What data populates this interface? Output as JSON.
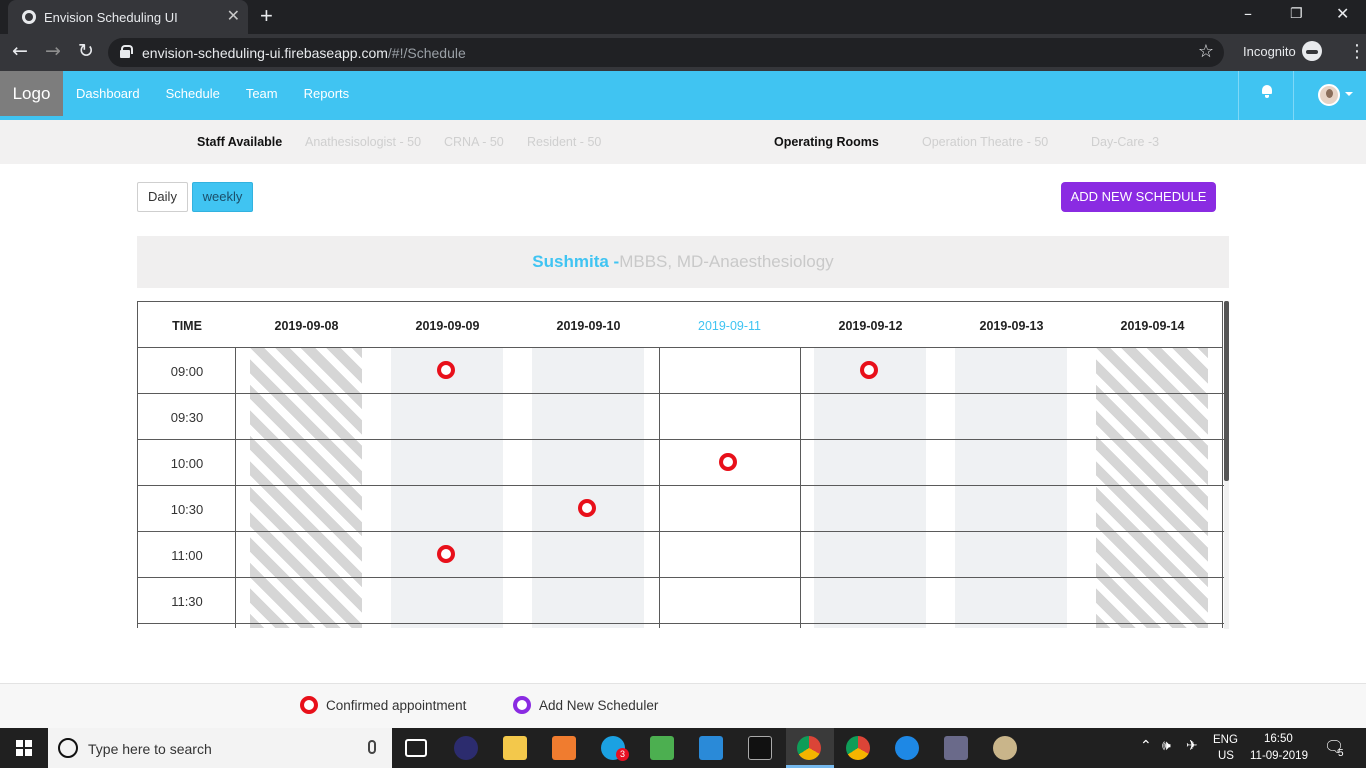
{
  "browser": {
    "tab_title": "Envision Scheduling UI",
    "close_glyph": "✕",
    "new_tab_glyph": "+",
    "url_host": "envision-scheduling-ui.firebaseapp.com",
    "url_path": "/#!/Schedule",
    "mode": "Incognito",
    "win_minimize": "–",
    "win_restore": "❐",
    "win_close": "✕",
    "back_glyph": "←",
    "forward_glyph": "→",
    "reload_glyph": "↻",
    "star_glyph": "☆",
    "menu_glyph": "⋮"
  },
  "header": {
    "logo": "Logo",
    "nav": [
      "Dashboard",
      "Schedule",
      "Team",
      "Reports"
    ],
    "accent_color": "#40c4f2"
  },
  "summary": {
    "staff_label": "Staff Available",
    "staff": [
      "Anathesisologist - 50",
      "CRNA - 50",
      "Resident - 50"
    ],
    "rooms_label": "Operating Rooms",
    "rooms": [
      "Operation Theatre - 50",
      "Day-Care -3"
    ]
  },
  "controls": {
    "daily": "Daily",
    "weekly": "weekly",
    "active_view": "weekly",
    "add_schedule": "ADD NEW SCHEDULE",
    "add_color": "#8a2be2"
  },
  "doctor": {
    "name": "Sushmita -",
    "qualifications": "MBBS, MD-Anaesthesiology"
  },
  "schedule": {
    "time_header": "TIME",
    "days": [
      {
        "date": "2019-09-08",
        "style": "blocked"
      },
      {
        "date": "2019-09-09",
        "style": "shaded"
      },
      {
        "date": "2019-09-10",
        "style": "shaded"
      },
      {
        "date": "2019-09-11",
        "style": "today"
      },
      {
        "date": "2019-09-12",
        "style": "shaded"
      },
      {
        "date": "2019-09-13",
        "style": "shaded"
      },
      {
        "date": "2019-09-14",
        "style": "blocked"
      }
    ],
    "times": [
      "09:00",
      "09:30",
      "10:00",
      "10:30",
      "11:00",
      "11:30"
    ],
    "appointments": [
      {
        "day": "2019-09-09",
        "time": "09:00"
      },
      {
        "day": "2019-09-12",
        "time": "09:00"
      },
      {
        "day": "2019-09-11",
        "time": "10:00"
      },
      {
        "day": "2019-09-10",
        "time": "10:30"
      },
      {
        "day": "2019-09-09",
        "time": "11:00"
      }
    ],
    "appointment_color": "#e8101a"
  },
  "legend": {
    "confirmed": "Confirmed appointment",
    "add_new": "Add New Scheduler"
  },
  "taskbar": {
    "search_placeholder": "Type here to search",
    "skype_badge": "3",
    "lang_top": "ENG",
    "lang_bottom": "US",
    "time": "16:50",
    "date": "11-09-2019",
    "notification_count": "5"
  }
}
